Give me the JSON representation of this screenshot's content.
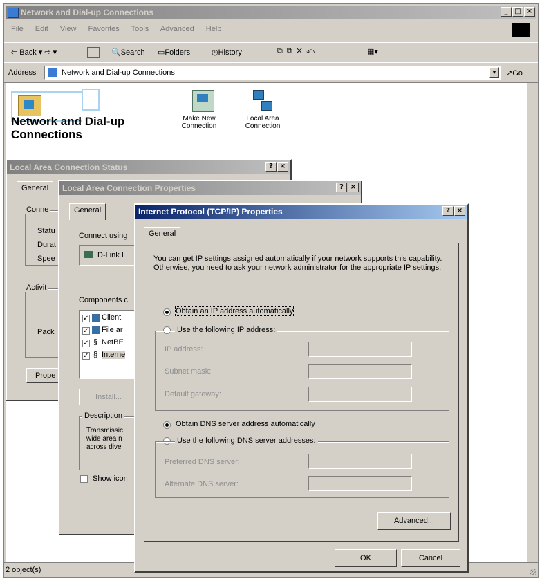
{
  "explorer": {
    "title": "Network and Dial-up Connections",
    "menu": [
      "File",
      "Edit",
      "View",
      "Favorites",
      "Tools",
      "Advanced",
      "Help"
    ],
    "toolbar": {
      "back": "Back",
      "search": "Search",
      "folders": "Folders",
      "history": "History"
    },
    "address_label": "Address",
    "address_value": "Network and Dial-up Connections",
    "go_label": "Go",
    "heading": "Network and Dial-up Connections",
    "icons": [
      {
        "label": "Make New Connection"
      },
      {
        "label": "Local Area Connection"
      }
    ],
    "status": "2 object(s)"
  },
  "status_dialog": {
    "title": "Local Area Connection Status",
    "tab": "General",
    "labels": [
      "Conne",
      "Statu",
      "Durat",
      "Spee"
    ],
    "activity": "Activit",
    "packets": "Pack",
    "properties_btn": "Prope"
  },
  "props_dialog": {
    "title": "Local Area Connection Properties",
    "tab": "General",
    "connect_using": "Connect using",
    "adapter": "D-Link I",
    "components_label": "Components c",
    "components": [
      "Client",
      "File ar",
      "NetBE",
      "Interne"
    ],
    "install_btn": "Install...",
    "description_label": "Description",
    "description_text": [
      "Transmissic",
      "wide area n",
      "across dive"
    ],
    "show_icon": "Show icon"
  },
  "tcpip": {
    "title": "Internet Protocol (TCP/IP) Properties",
    "tab": "General",
    "intro": "You can get IP settings assigned automatically if your network supports this capability. Otherwise, you need to ask your network administrator for the appropriate IP settings.",
    "obtain_ip": "Obtain an IP address automatically",
    "use_ip": "Use the following IP address:",
    "ip_address": "IP address:",
    "subnet_mask": "Subnet mask:",
    "default_gateway": "Default gateway:",
    "obtain_dns": "Obtain DNS server address automatically",
    "use_dns": "Use the following DNS server addresses:",
    "preferred_dns": "Preferred DNS server:",
    "alternate_dns": "Alternate DNS server:",
    "advanced_btn": "Advanced...",
    "ok_btn": "OK",
    "cancel_btn": "Cancel"
  }
}
